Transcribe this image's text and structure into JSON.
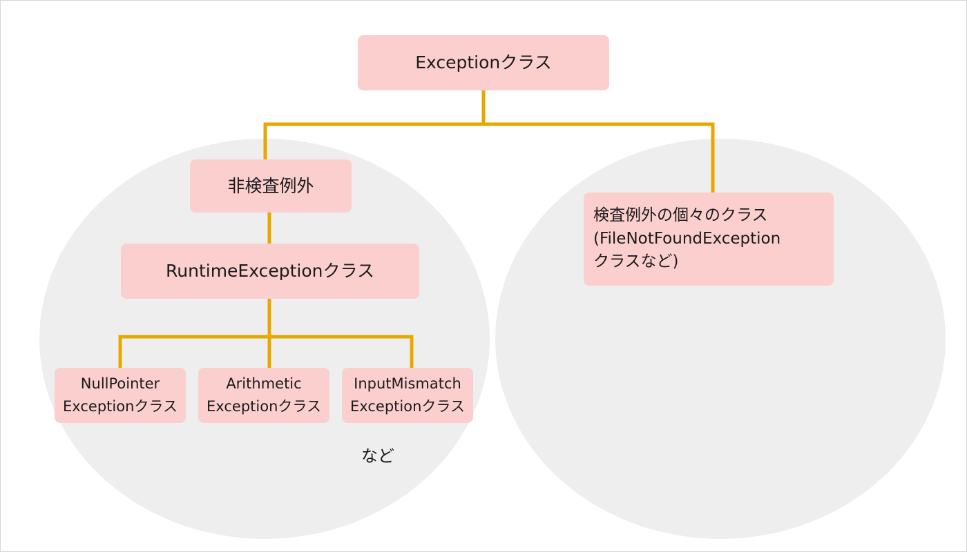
{
  "diagram": {
    "root": {
      "label": "Exceptionクラス"
    },
    "unchecked": {
      "label": "非検査例外",
      "runtime": {
        "label": "RuntimeExceptionクラス"
      },
      "children": [
        {
          "line1": "NullPointer",
          "line2": "Exceptionクラス"
        },
        {
          "line1": "Arithmetic",
          "line2": "Exceptionクラス"
        },
        {
          "line1": "InputMismatch",
          "line2": "Exceptionクラス"
        }
      ],
      "etc": "など"
    },
    "checked": {
      "line1": "検査例外の個々のクラス",
      "line2": "(FileNotFoundException",
      "line3": "クラスなど)"
    },
    "colors": {
      "node_fill": "#fccfcf",
      "connector": "#e6a800",
      "group_fill": "#eeeeee"
    }
  }
}
